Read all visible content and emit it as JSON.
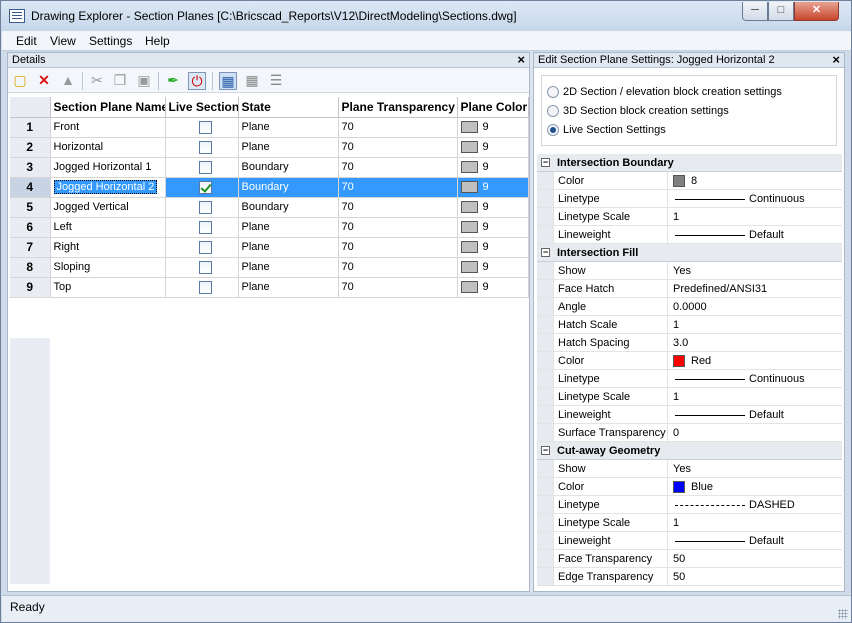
{
  "window": {
    "title": "Drawing Explorer - Section Planes [C:\\Bricscad_Reports\\V12\\DirectModeling\\Sections.dwg]"
  },
  "menu": [
    "Edit",
    "View",
    "Settings",
    "Help"
  ],
  "left_pane": {
    "title": "Details",
    "columns": [
      "Section Plane Name",
      "Live Section",
      "State",
      "Plane Transparency",
      "Plane Color"
    ],
    "rows": [
      {
        "n": "1",
        "name": "Front",
        "live": false,
        "state": "Plane",
        "transparency": "70",
        "color": "9"
      },
      {
        "n": "2",
        "name": "Horizontal",
        "live": false,
        "state": "Plane",
        "transparency": "70",
        "color": "9"
      },
      {
        "n": "3",
        "name": "Jogged Horizontal 1",
        "live": false,
        "state": "Boundary",
        "transparency": "70",
        "color": "9"
      },
      {
        "n": "4",
        "name": "Jogged Horizontal 2",
        "live": true,
        "state": "Boundary",
        "transparency": "70",
        "color": "9",
        "selected": true
      },
      {
        "n": "5",
        "name": "Jogged Vertical",
        "live": false,
        "state": "Boundary",
        "transparency": "70",
        "color": "9"
      },
      {
        "n": "6",
        "name": "Left",
        "live": false,
        "state": "Plane",
        "transparency": "70",
        "color": "9"
      },
      {
        "n": "7",
        "name": "Right",
        "live": false,
        "state": "Plane",
        "transparency": "70",
        "color": "9"
      },
      {
        "n": "8",
        "name": "Sloping",
        "live": false,
        "state": "Plane",
        "transparency": "70",
        "color": "9"
      },
      {
        "n": "9",
        "name": "Top",
        "live": false,
        "state": "Plane",
        "transparency": "70",
        "color": "9"
      }
    ],
    "swatch_color": "#c0c0c0"
  },
  "right_pane": {
    "title": "Edit Section Plane Settings: Jogged Horizontal 2",
    "options": [
      {
        "label": "2D Section / elevation block creation settings",
        "selected": false
      },
      {
        "label": "3D Section block creation settings",
        "selected": false
      },
      {
        "label": "Live Section Settings",
        "selected": true
      }
    ],
    "sections": [
      {
        "title": "Intersection Boundary",
        "rows": [
          {
            "label": "Color",
            "value": "8",
            "swatch": "#808080"
          },
          {
            "label": "Linetype",
            "value": "Continuous",
            "line": "solid"
          },
          {
            "label": "Linetype Scale",
            "value": "1"
          },
          {
            "label": "Lineweight",
            "value": "Default",
            "line": "solid"
          }
        ]
      },
      {
        "title": "Intersection Fill",
        "rows": [
          {
            "label": "Show",
            "value": "Yes"
          },
          {
            "label": "Face Hatch",
            "value": "Predefined/ANSI31"
          },
          {
            "label": "Angle",
            "value": "0.0000"
          },
          {
            "label": "Hatch Scale",
            "value": "1"
          },
          {
            "label": "Hatch Spacing",
            "value": "3.0"
          },
          {
            "label": "Color",
            "value": "Red",
            "swatch": "#ff0000"
          },
          {
            "label": "Linetype",
            "value": "Continuous",
            "line": "solid"
          },
          {
            "label": "Linetype Scale",
            "value": "1"
          },
          {
            "label": "Lineweight",
            "value": "Default",
            "line": "solid"
          },
          {
            "label": "Surface Transparency",
            "value": "0"
          }
        ]
      },
      {
        "title": "Cut-away Geometry",
        "rows": [
          {
            "label": "Show",
            "value": "Yes"
          },
          {
            "label": "Color",
            "value": "Blue",
            "swatch": "#0000ff"
          },
          {
            "label": "Linetype",
            "value": "DASHED",
            "line": "dash"
          },
          {
            "label": "Linetype Scale",
            "value": "1"
          },
          {
            "label": "Lineweight",
            "value": "Default",
            "line": "solid"
          },
          {
            "label": "Face Transparency",
            "value": "50"
          },
          {
            "label": "Edge Transparency",
            "value": "50"
          }
        ]
      }
    ]
  },
  "status": {
    "text": "Ready"
  },
  "icons": {
    "toolbar": [
      "new-icon",
      "delete-icon",
      "purge-icon",
      "cut-icon",
      "copy-icon",
      "paste-icon",
      "edit-pen-icon",
      "live-section-icon",
      "table-view-icon",
      "grid-view-icon",
      "tree-view-icon"
    ]
  }
}
